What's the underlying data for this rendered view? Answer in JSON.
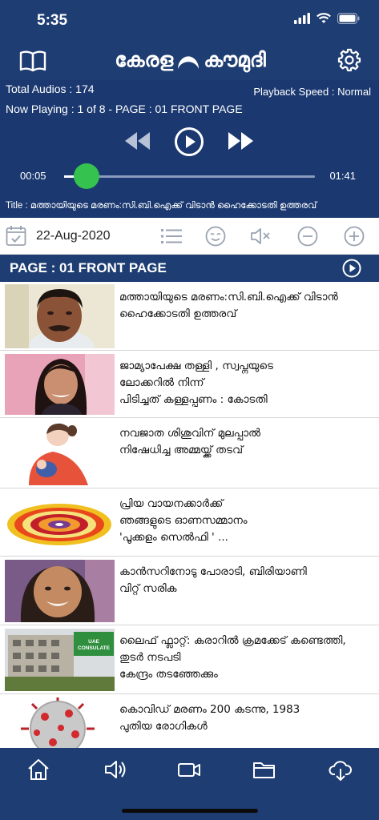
{
  "status_bar": {
    "time": "5:35",
    "icons": [
      "cellular-signal-icon",
      "wifi-icon",
      "battery-icon"
    ]
  },
  "app_bar": {
    "logo_text": "കേരള",
    "logo_text_2": "കൗമുദി",
    "left_icon": "book-icon",
    "right_icon": "gear-icon"
  },
  "player": {
    "total_audios": "Total Audios :  174",
    "playback_speed": "Playback Speed : Normal",
    "now_playing": "Now Playing :  1 of 8 - PAGE :  01 FRONT PAGE",
    "current_time": "00:05",
    "duration": "01:41",
    "progress": 0.09,
    "title": "Title : മത്തായിയുടെ മരണം:സി.ബി.ഐക്ക് വിടാൻ ഹൈക്കോടതി ഉത്തരവ്"
  },
  "toolbar": {
    "date": "22-Aug-2020",
    "icons": [
      "calendar-icon",
      "list-icon",
      "emoji-icon",
      "mute-icon",
      "zoom-out-icon",
      "zoom-in-icon"
    ]
  },
  "section": {
    "label": "PAGE : 01 FRONT PAGE"
  },
  "articles": [
    {
      "text": "മത്തായിയുടെ മരണം:സി.ബി.ഐക്ക് വിടാൻ\nഹൈക്കോടതി ഉത്തരവ്"
    },
    {
      "text": "ജാമ്യാപേക്ഷ തള്ളി , സ്വപ്നയുടെ\nലോക്കറിൽ നിന്ന്\nപിടിച്ചത് കള്ളപ്പണം   : കോടതി"
    },
    {
      "text": "നവജാത ശിശുവിന് മുലപ്പാൽ\nനിഷേധിച്ച അമ്മയ്ക്ക് തടവ്"
    },
    {
      "text": "പ്രിയ വായനക്കാർക്ക്\nഞങ്ങളുടെ  ഓണസമ്മാനം\n'പൂക്കളം സെൽഫി ' ..."
    },
    {
      "text": "കാൻസറിനോടു പോരാടി, ബിരിയാണി\nവിറ്റ് സരിക"
    },
    {
      "text": "ലൈഫ് ഫ്ലാറ്റ്: കരാറിൽ ക്രമക്കേട് കണ്ടെത്തി,\nതുടർ നടപടി\nകേന്ദ്രം തടഞ്ഞേക്കും"
    },
    {
      "text": "കൊവിഡ് മരണം 200 കടന്നു, 1983\nപുതിയ രോഗികൾ"
    }
  ],
  "sign_text": "UAE CONSULATE",
  "tab_bar": {
    "tabs": [
      "home-icon",
      "audio-icon",
      "video-icon",
      "folder-icon",
      "download-icon"
    ]
  },
  "colors": {
    "primary": "#1e3d72",
    "accent": "#35c24f"
  }
}
